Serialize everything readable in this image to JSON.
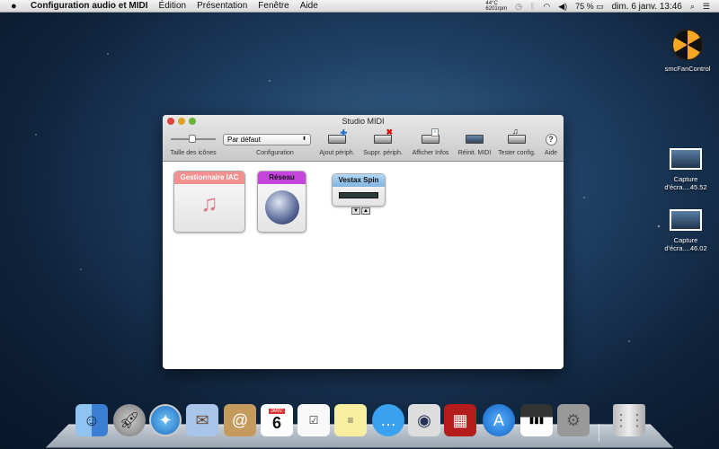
{
  "menubar": {
    "app": "Configuration audio et MIDI",
    "items": [
      "Édition",
      "Présentation",
      "Fenêtre",
      "Aide"
    ],
    "temp": "44°C",
    "rpm": "6201rpm",
    "battery": "75 %",
    "datetime": "dim. 6 janv.  13:46"
  },
  "window": {
    "title": "Studio MIDI",
    "toolbar": {
      "icon_size_label": "Taille des icônes",
      "config_value": "Par défaut",
      "config_label": "Configuration",
      "add": "Ajout périph.",
      "remove": "Suppr. périph.",
      "info": "Afficher Infos",
      "reset": "Réinit. MIDI",
      "test": "Tester config.",
      "help": "Aide"
    },
    "devices": [
      {
        "name": "Gestionnaire IAC",
        "color": "#f08a8a"
      },
      {
        "name": "Réseau",
        "color": "#c040d8"
      },
      {
        "name": "Vestax Spin",
        "color": "#8ec0e8"
      }
    ]
  },
  "desktop": [
    {
      "label": "smcFanControl"
    },
    {
      "label": "Capture d'écra....45.52"
    },
    {
      "label": "Capture d'écra....46.02"
    }
  ],
  "dock": {
    "calendar_month": "JANV.",
    "calendar_day": "6",
    "apps": [
      "finder",
      "launchpad",
      "safari",
      "mail",
      "contacts",
      "calendar",
      "reminders",
      "notes",
      "messages",
      "facetime",
      "photo-booth",
      "app-store",
      "audio-midi-setup",
      "system-preferences",
      "trash"
    ]
  }
}
